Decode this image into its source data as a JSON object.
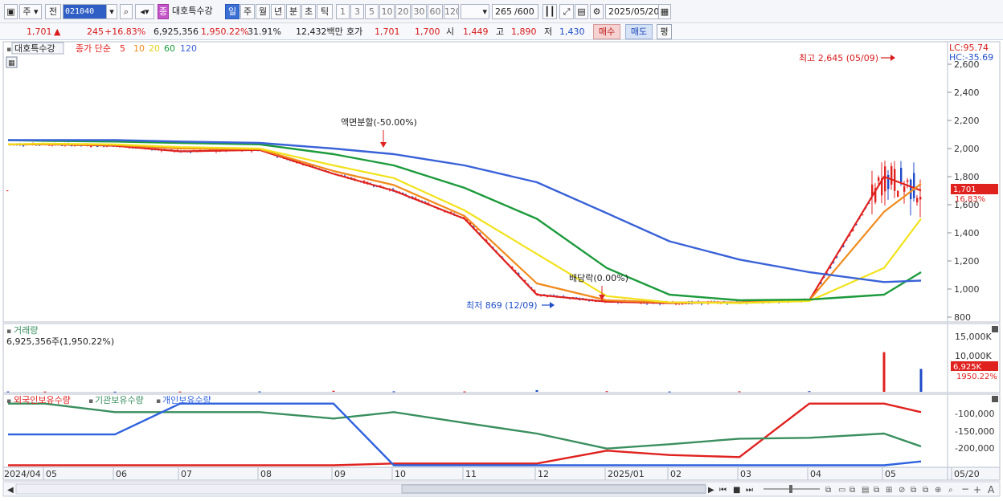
{
  "toolbar": {
    "market": "주",
    "market_all": "전",
    "stock_code": "021040",
    "stock_badge": "종",
    "stock_name": "대호특수강",
    "periods": [
      "일",
      "주",
      "월",
      "년",
      "분",
      "초",
      "틱"
    ],
    "intervals": [
      "1",
      "3",
      "5",
      "10",
      "20",
      "30",
      "60",
      "120"
    ],
    "count_value": "265",
    "count_total": "/600",
    "date": "2025/05/20"
  },
  "quote": {
    "price": "1,701",
    "change_arrow": "▲",
    "change": "245",
    "change_pct": "+16.83%",
    "volume": "6,925,356",
    "volume_ratio": "1,950.22%",
    "turnover": "31.91%",
    "amount": "12,432백만",
    "bid_label": "호가",
    "bid1": "1,701",
    "bid2": "1,700",
    "open_label": "시",
    "open": "1,449",
    "high_label": "고",
    "high": "1,890",
    "low_label": "저",
    "low": "1,430",
    "buy_label": "매수",
    "sell_label": "매도",
    "avg_label": "평"
  },
  "price_pane": {
    "stock_name": "대호특수강",
    "legend_label": "종가 단순",
    "ma_periods": [
      "5",
      "10",
      "20",
      "60",
      "120"
    ],
    "y_ticks": [
      "2,600",
      "2,400",
      "2,200",
      "2,000",
      "1,800",
      "1,600",
      "1,400",
      "1,200",
      "1,000",
      "800"
    ],
    "lc": "LC:95.74",
    "hc": "HC:-35.69",
    "current_price": "1,701",
    "current_pct": "16.83%",
    "annotation_split": "액면분할(-50.00%)",
    "annotation_dividend": "배당락(0.00%)",
    "annotation_low": "최저 869 (12/09)",
    "annotation_high": "최고 2,645 (05/09)"
  },
  "volume_pane": {
    "title": "거래량",
    "value_text": "6,925,356주(1,950.22%)",
    "y_ticks": [
      "15,000K",
      "10,000K"
    ],
    "current": "6,925K",
    "current_pct": "1950.22%"
  },
  "holding_pane": {
    "legend": [
      "외국인보유수량",
      "기관보유수량",
      "개인보유수량"
    ],
    "y_ticks": [
      "-100,000",
      "-150,000",
      "-200,000"
    ]
  },
  "x_axis": {
    "labels": [
      "2024/04",
      "05",
      "06",
      "07",
      "08",
      "09",
      "10",
      "11",
      "12",
      "2025/01",
      "02",
      "03",
      "04",
      "05",
      "05/20"
    ]
  },
  "colors": {
    "candle_up": "#e0221f",
    "candle_down": "#1f4ac9",
    "ma5": "#e0221f",
    "ma10": "#f08a1c",
    "ma20": "#f2e21c",
    "ma60": "#1c9a3c",
    "ma120": "#3a62d8",
    "foreign": "#e0221f",
    "institution": "#3a8f5f",
    "individual": "#2f62de"
  },
  "chart_data": [
    {
      "type": "line",
      "title": "대호특수강",
      "xlabel": "",
      "ylabel": "",
      "ylim": [
        780,
        2650
      ],
      "x": [
        "2024/04",
        "05",
        "06",
        "07",
        "08",
        "09",
        "10",
        "11",
        "12",
        "2025/01",
        "02",
        "03",
        "04",
        "05",
        "05/20"
      ],
      "series": [
        {
          "name": "5",
          "values": [
            2030,
            2030,
            2020,
            1980,
            1990,
            1820,
            1700,
            1500,
            960,
            910,
            900,
            905,
            920,
            1800,
            1701
          ]
        },
        {
          "name": "10",
          "values": [
            2030,
            2030,
            2025,
            2000,
            1995,
            1840,
            1740,
            1520,
            1040,
            920,
            905,
            905,
            920,
            1550,
            1750
          ]
        },
        {
          "name": "20",
          "values": [
            2030,
            2035,
            2030,
            2010,
            2000,
            1880,
            1790,
            1560,
            1250,
            950,
            905,
            900,
            915,
            1150,
            1500
          ]
        },
        {
          "name": "60",
          "values": [
            2060,
            2055,
            2050,
            2040,
            2030,
            1960,
            1880,
            1720,
            1500,
            1150,
            960,
            920,
            925,
            960,
            1120
          ]
        },
        {
          "name": "120",
          "values": [
            2060,
            2060,
            2060,
            2050,
            2040,
            2000,
            1960,
            1880,
            1760,
            1540,
            1340,
            1210,
            1120,
            1050,
            1060
          ]
        }
      ],
      "annotations": [
        "액면분할(-50.00%)",
        "배당락(0.00%)",
        "최저 869 (12/09)",
        "최고 2,645 (05/09)"
      ]
    },
    {
      "type": "bar",
      "title": "거래량",
      "ylabel": "",
      "ylim": [
        0,
        17000
      ],
      "x": [
        "2024/04",
        "05",
        "06",
        "07",
        "08",
        "09",
        "10",
        "11",
        "12",
        "2025/01",
        "02",
        "03",
        "04",
        "05",
        "05/20"
      ],
      "values": [
        100,
        80,
        60,
        90,
        120,
        300,
        150,
        120,
        500,
        200,
        100,
        150,
        200,
        12000,
        6925
      ]
    },
    {
      "type": "line",
      "title": "",
      "ylim": [
        -235000,
        -85000
      ],
      "x": [
        "2024/04",
        "05",
        "06",
        "07",
        "08",
        "09",
        "10",
        "11",
        "12",
        "2025/01",
        "02",
        "03",
        "04",
        "05",
        "05/20"
      ],
      "series": [
        {
          "name": "외국인보유수량",
          "values": [
            -234000,
            -234000,
            -234000,
            -234000,
            -234000,
            -234000,
            -230000,
            -230000,
            -230000,
            -200000,
            -210000,
            -215000,
            -90000,
            -90000,
            -110000
          ]
        },
        {
          "name": "기관보유수량",
          "values": [
            -90000,
            -90000,
            -110000,
            -110000,
            -110000,
            -125000,
            -110000,
            -135000,
            -160000,
            -195000,
            -185000,
            -172000,
            -170000,
            -160000,
            -190000
          ]
        },
        {
          "name": "개인보유수량",
          "values": [
            -162000,
            -162000,
            -162000,
            -90000,
            -90000,
            -90000,
            -234000,
            -234000,
            -234000,
            -234000,
            -234000,
            -234000,
            -234000,
            -234000,
            -225000
          ]
        }
      ]
    }
  ]
}
